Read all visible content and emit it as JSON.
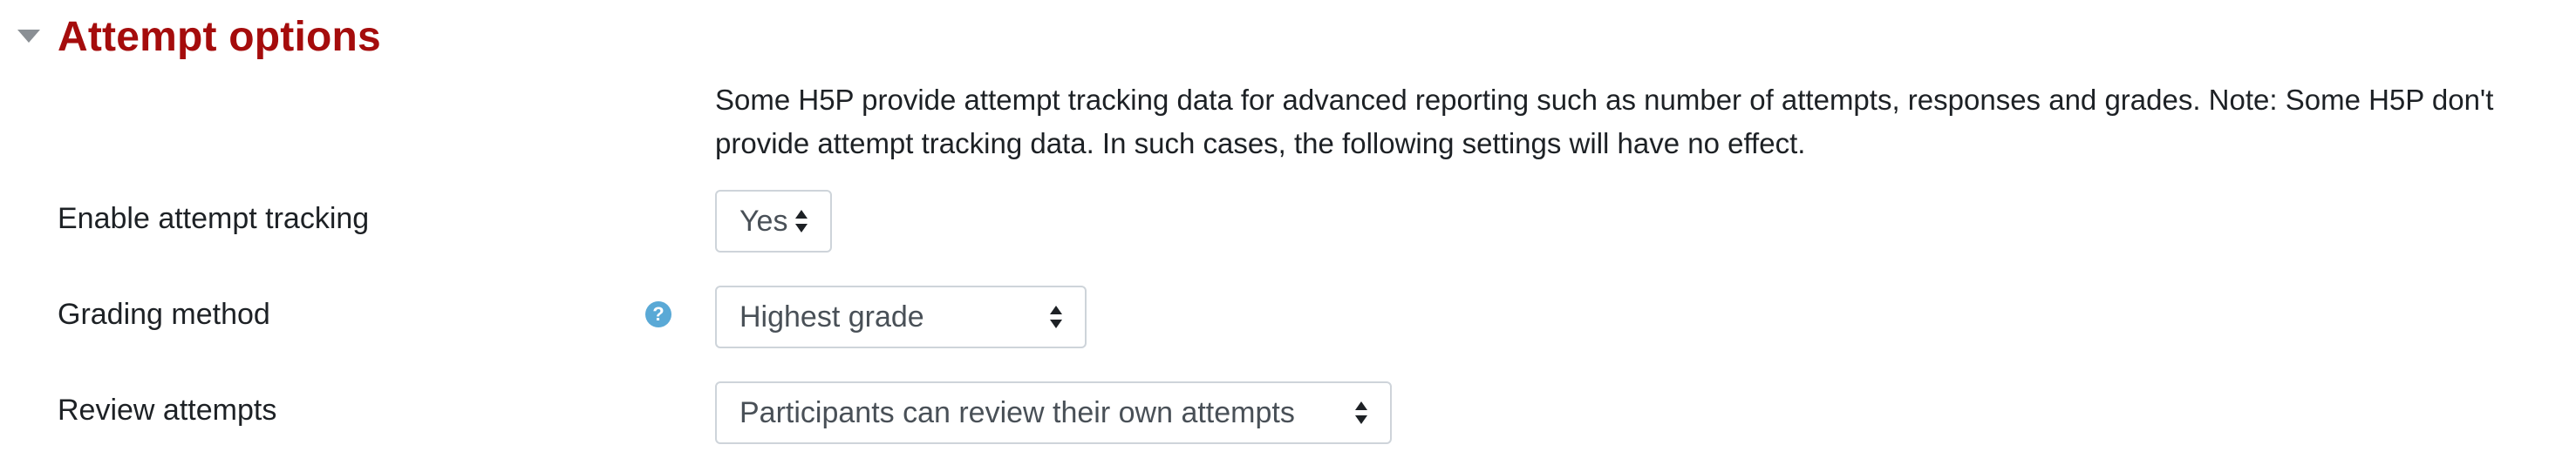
{
  "section": {
    "title": "Attempt options",
    "collapse_icon": "caret-down-icon"
  },
  "description": "Some H5P provide attempt tracking data for advanced reporting such as number of attempts, responses and grades. Note: Some H5P don't provide attempt tracking data. In such cases, the following settings will have no effect.",
  "fields": {
    "enable_tracking": {
      "label": "Enable attempt tracking",
      "value": "Yes"
    },
    "grading_method": {
      "label": "Grading method",
      "value": "Highest grade",
      "help_icon": "question-circle-icon",
      "help_glyph": "?"
    },
    "review_attempts": {
      "label": "Review attempts",
      "value": "Participants can review their own attempts"
    }
  },
  "colors": {
    "section_title": "#a50c0c",
    "text": "#1d2125",
    "select_border": "#ced4da",
    "help_icon": "#5aa9d6"
  }
}
